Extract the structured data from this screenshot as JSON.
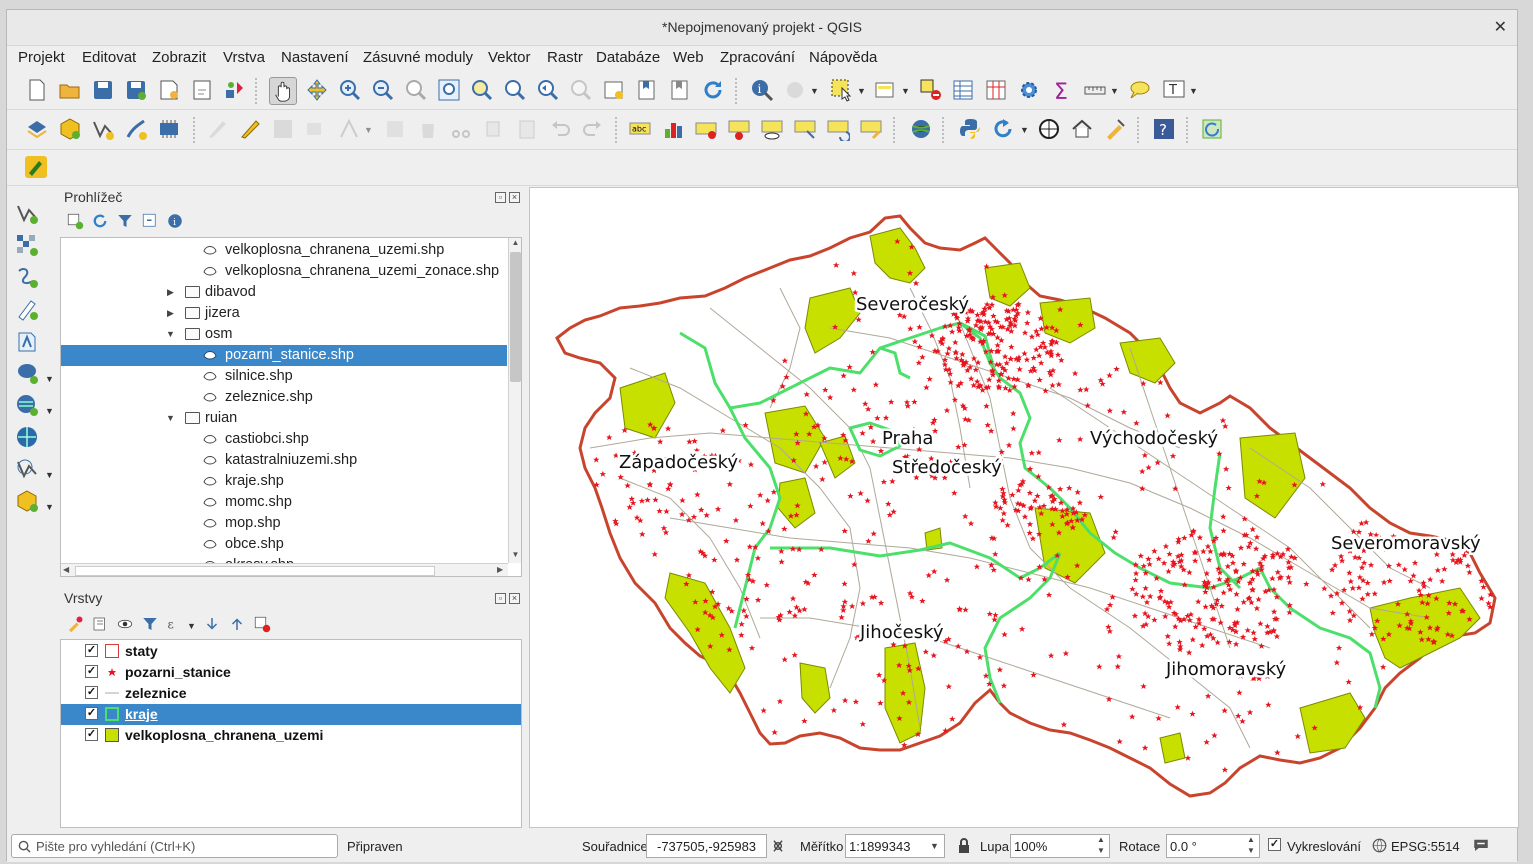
{
  "window": {
    "title": "*Nepojmenovaný projekt - QGIS",
    "close_glyph": "✕"
  },
  "menu": [
    "Projekt",
    "Editovat",
    "Zobrazit",
    "Vrstva",
    "Nastavení",
    "Zásuvné moduly",
    "Vektor",
    "Rastr",
    "Databáze",
    "Web",
    "Zpracování",
    "Nápověda"
  ],
  "browser": {
    "title": "Prohlížeč",
    "items": [
      {
        "label": "velkoplosna_chranena_uzemi.shp",
        "kind": "file"
      },
      {
        "label": "velkoplosna_chranena_uzemi_zonace.shp",
        "kind": "file"
      },
      {
        "label": "dibavod",
        "kind": "folder",
        "expanded": false
      },
      {
        "label": "jizera",
        "kind": "folder",
        "expanded": false
      },
      {
        "label": "osm",
        "kind": "folder",
        "expanded": true
      },
      {
        "label": "pozarni_stanice.shp",
        "kind": "file",
        "selected": true
      },
      {
        "label": "silnice.shp",
        "kind": "file"
      },
      {
        "label": "zeleznice.shp",
        "kind": "file"
      },
      {
        "label": "ruian",
        "kind": "folder",
        "expanded": true
      },
      {
        "label": "castiobci.shp",
        "kind": "file"
      },
      {
        "label": "katastralniuzemi.shp",
        "kind": "file"
      },
      {
        "label": "kraje.shp",
        "kind": "file"
      },
      {
        "label": "momc.shp",
        "kind": "file"
      },
      {
        "label": "mop.shp",
        "kind": "file"
      },
      {
        "label": "obce.shp",
        "kind": "file"
      },
      {
        "label": "okresy.shp",
        "kind": "file"
      }
    ]
  },
  "layers": {
    "title": "Vrstvy",
    "items": [
      {
        "label": "staty",
        "checked": true,
        "symbol": "outline-red"
      },
      {
        "label": "pozarni_stanice",
        "checked": true,
        "symbol": "star-red"
      },
      {
        "label": "zeleznice",
        "checked": true,
        "symbol": "line-gray"
      },
      {
        "label": "kraje",
        "checked": true,
        "symbol": "outline-green",
        "selected": true
      },
      {
        "label": "velkoplosna_chranena_uzemi",
        "checked": true,
        "symbol": "fill-yellowgreen"
      }
    ]
  },
  "map": {
    "region_labels": [
      "Severočeský",
      "Praha",
      "Středočeský",
      "Západočeský",
      "Východočeský",
      "Severomoravský",
      "Jihočeský",
      "Jihomoravský"
    ],
    "colors": {
      "border": "#c8442c",
      "regions": "#4cdf6a",
      "protected": "#c8e000",
      "stations": "#e8141e",
      "rail": "#b0a898"
    }
  },
  "status": {
    "search_placeholder": "Pište pro vyhledání (Ctrl+K)",
    "ready": "Připraven",
    "coord_label": "Souřadnice",
    "coord_value": "-737505,-925983",
    "scale_label": "Měřítko",
    "scale_value": "1:1899343",
    "zoom_label": "Lupa",
    "zoom_value": "100%",
    "rotation_label": "Rotace",
    "rotation_value": "0.0 °",
    "render_label": "Vykreslování",
    "render_checked": true,
    "crs": "EPSG:5514"
  }
}
